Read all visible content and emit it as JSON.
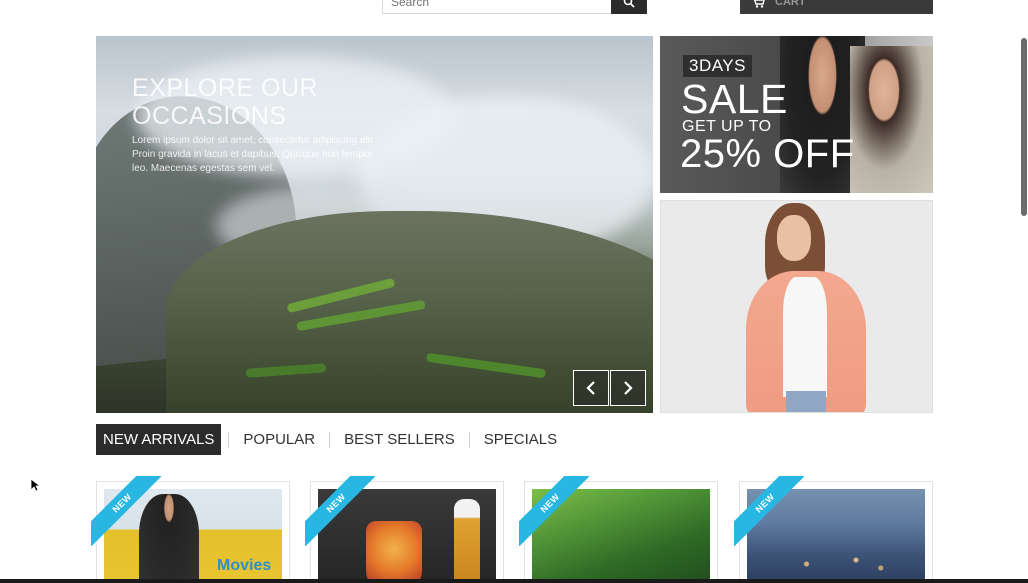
{
  "header": {
    "search_placeholder": "Search",
    "cart_label": "CART"
  },
  "slider": {
    "title_line1": "EXPLORE OUR",
    "title_line2": "OCCASIONS",
    "description": "Lorem ipsum dolor sit amet, consectetur adipiscing elit. Proin gravida in lacus et dapibus. Quisque non tempor leo. Maecenas egestas sem vel.",
    "prev_icon": "chevron-left-icon",
    "next_icon": "chevron-right-icon"
  },
  "banner_sale": {
    "tag": "3DAYS",
    "headline": "SALE",
    "sub": "GET UP TO",
    "percent": "25% OFF"
  },
  "tabs": [
    {
      "label": "NEW ARRIVALS",
      "active": true
    },
    {
      "label": "POPULAR",
      "active": false
    },
    {
      "label": "BEST SELLERS",
      "active": false
    },
    {
      "label": "SPECIALS",
      "active": false
    }
  ],
  "products": [
    {
      "badge": "NEW",
      "thumb_text": "Movies"
    },
    {
      "badge": "NEW"
    },
    {
      "badge": "NEW"
    },
    {
      "badge": "NEW"
    }
  ],
  "colors": {
    "accent": "#27b7e2",
    "dark": "#2b2b2b"
  }
}
